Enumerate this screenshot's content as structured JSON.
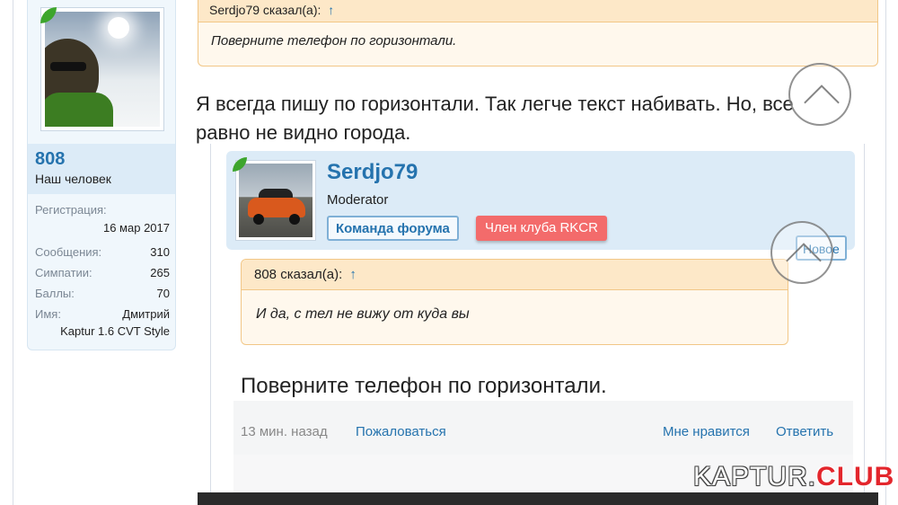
{
  "sidebar": {
    "username": "808",
    "usertitle": "Наш человек",
    "stats": {
      "reg_label": "Регистрация:",
      "reg_value": "16 мар 2017",
      "messages_label": "Сообщения:",
      "messages_value": "310",
      "likes_label": "Симпатии:",
      "likes_value": "265",
      "points_label": "Баллы:",
      "points_value": "70",
      "name_label": "Имя:",
      "name_value": "Дмитрий",
      "car": "Kaptur 1.6 CVT Style"
    }
  },
  "quote_top": {
    "author": "Serdjo79 сказал(а):",
    "link": "↑",
    "text": "Поверните телефон по горизонтали."
  },
  "message": {
    "text": "Я всегда пишу по горизонтали. Так легче текст набивать. Но, все равно не видно города."
  },
  "embedded": {
    "mod_name": "Serdjo79",
    "mod_role": "Moderator",
    "badge_team": "Команда форума",
    "badge_club": "Член клуба RKCR",
    "badge_new": "Новое",
    "quote_author": "808 сказал(а):",
    "quote_link": "↑",
    "quote_text": "И да, с тел не вижу от куда вы",
    "msg": "Поверните телефон по горизонтали.",
    "time": "13 мин. назад",
    "report": "Пожаловаться",
    "like": "Мне нравится",
    "reply": "Ответить"
  },
  "watermark": {
    "part1": "KAPTUR.",
    "part2": "CLUB"
  },
  "colors": {
    "accent": "#2573ae",
    "quote_bg": "#fff8ed",
    "quote_border": "#f2c787",
    "badge_club": "#f36b6b"
  }
}
